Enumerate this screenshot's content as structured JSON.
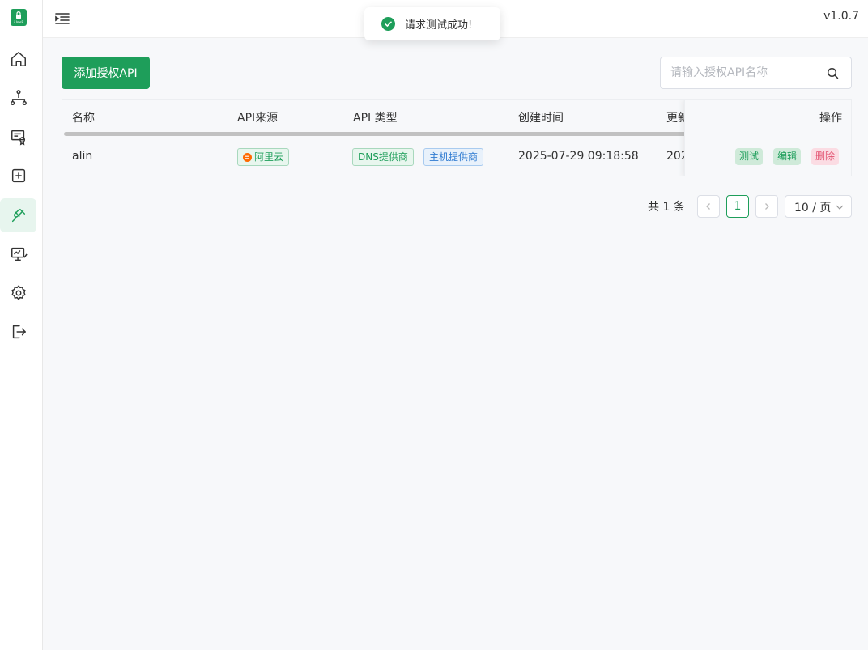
{
  "app": {
    "logo_text": "iUmsE",
    "version": "v1.0.7"
  },
  "sidebar": {
    "items": [
      {
        "icon": "home-icon"
      },
      {
        "icon": "sitemap-icon"
      },
      {
        "icon": "certificate-icon"
      },
      {
        "icon": "add-square-icon"
      },
      {
        "icon": "plug-icon",
        "active": true
      },
      {
        "icon": "monitor-icon"
      },
      {
        "icon": "gear-icon"
      },
      {
        "icon": "logout-icon"
      }
    ]
  },
  "toast": {
    "message": "请求测试成功!"
  },
  "toolbar": {
    "add_label": "添加授权API",
    "search_placeholder": "请输入授权API名称"
  },
  "table": {
    "columns": [
      "名称",
      "API来源",
      "API 类型",
      "创建时间",
      "更新",
      "操作"
    ],
    "rows": [
      {
        "name": "alin",
        "source": "阿里云",
        "types": [
          "DNS提供商",
          "主机提供商"
        ],
        "created": "2025-07-29 09:18:58",
        "updated": "202"
      }
    ],
    "actions": {
      "test": "测试",
      "edit": "编辑",
      "delete": "删除"
    }
  },
  "pagination": {
    "total": "共 1 条",
    "current_page": "1",
    "page_size": "10 / 页"
  },
  "colors": {
    "primary": "#1e9e5a",
    "danger": "#e2506f",
    "info": "#2f7bd1"
  }
}
